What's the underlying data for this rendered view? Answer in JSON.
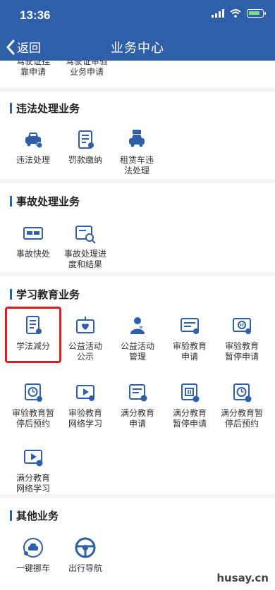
{
  "status_bar": {
    "time": "13:36"
  },
  "navbar": {
    "back_label": "返回",
    "title": "业务中心"
  },
  "top_partial_items": [
    {
      "label_lines": [
        "驾驶证挂",
        "靠申请"
      ]
    },
    {
      "label_lines": [
        "驾驶证审验",
        "业务申请"
      ]
    }
  ],
  "sections": [
    {
      "title": "违法处理业务",
      "items": [
        {
          "label_lines": [
            "违法处理"
          ],
          "icon": "car-icon"
        },
        {
          "label_lines": [
            "罚款缴纳"
          ],
          "icon": "receipt-icon"
        },
        {
          "label_lines": [
            "租赁车违",
            "法处理"
          ],
          "icon": "rental-car-icon"
        }
      ]
    },
    {
      "title": "事故处理业务",
      "items": [
        {
          "label_lines": [
            "事故快处"
          ],
          "icon": "accident-icon"
        },
        {
          "label_lines": [
            "事故处理进",
            "度和结果"
          ],
          "icon": "progress-search-icon"
        }
      ]
    },
    {
      "title": "学习教育业务",
      "items": [
        {
          "label_lines": [
            "学法减分"
          ],
          "icon": "study-notebook-icon"
        },
        {
          "label_lines": [
            "公益活动",
            "公示"
          ],
          "icon": "heart-board-icon"
        },
        {
          "label_lines": [
            "公益活动",
            "管理"
          ],
          "icon": "volunteer-icon"
        },
        {
          "label_lines": [
            "审验教育",
            "申请"
          ],
          "icon": "monitor-doc-icon"
        },
        {
          "label_lines": [
            "审验教育",
            "暂停申请"
          ],
          "icon": "pause-doc-icon"
        },
        {
          "label_lines": [
            "审验教育暂",
            "停后预约"
          ],
          "icon": "clock-doc-icon"
        },
        {
          "label_lines": [
            "审验教育",
            "网络学习"
          ],
          "icon": "video-icon"
        },
        {
          "label_lines": [
            "满分教育",
            "申请"
          ],
          "icon": "score-doc-icon"
        },
        {
          "label_lines": [
            "满分教育",
            "暂停申请"
          ],
          "icon": "score-pause-icon"
        },
        {
          "label_lines": [
            "满分教育暂",
            "停后预约"
          ],
          "icon": "score-clock-icon"
        },
        {
          "label_lines": [
            "满分教育",
            "网络学习"
          ],
          "icon": "score-video-icon"
        }
      ]
    },
    {
      "title": "其他业务",
      "items": [
        {
          "label_lines": [
            "一键挪车"
          ],
          "icon": "move-car-icon"
        },
        {
          "label_lines": [
            "出行导航"
          ],
          "icon": "steering-wheel-icon"
        }
      ]
    }
  ],
  "watermark": "husay.cn",
  "colors": {
    "brand": "#2f5fa8",
    "highlight": "#e11b1b"
  }
}
